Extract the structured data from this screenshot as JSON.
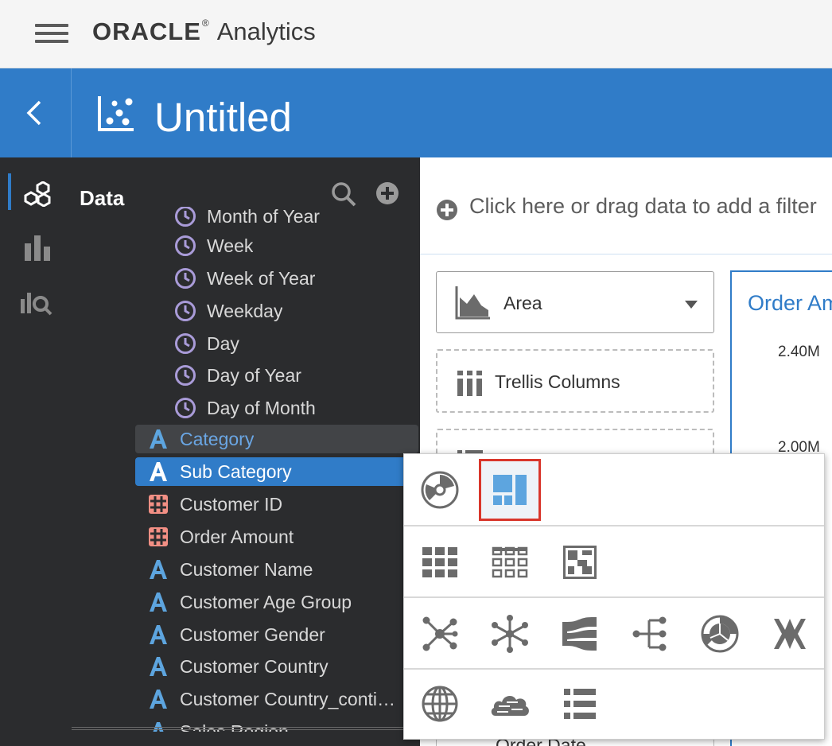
{
  "header": {
    "brand_oracle": "ORACLE",
    "brand_reg": "®",
    "brand_product": "Analytics"
  },
  "titlebar": {
    "project_title": "Untitled"
  },
  "data_panel": {
    "title": "Data",
    "items": [
      {
        "label": "Month of Year",
        "type": "time"
      },
      {
        "label": "Week",
        "type": "time"
      },
      {
        "label": "Week of Year",
        "type": "time"
      },
      {
        "label": "Weekday",
        "type": "time"
      },
      {
        "label": "Day",
        "type": "time"
      },
      {
        "label": "Day of Year",
        "type": "time"
      },
      {
        "label": "Day of Month",
        "type": "time"
      },
      {
        "label": "Category",
        "type": "attribute",
        "state": "hover"
      },
      {
        "label": "Sub Category",
        "type": "attribute",
        "state": "selected"
      },
      {
        "label": "Customer ID",
        "type": "measure"
      },
      {
        "label": "Order Amount",
        "type": "measure"
      },
      {
        "label": "Customer Name",
        "type": "attribute"
      },
      {
        "label": "Customer Age Group",
        "type": "attribute"
      },
      {
        "label": "Customer Gender",
        "type": "attribute"
      },
      {
        "label": "Customer Country",
        "type": "attribute"
      },
      {
        "label": "Customer Country_conti…",
        "type": "attribute"
      },
      {
        "label": "Sales Region",
        "type": "attribute"
      }
    ]
  },
  "filterbar": {
    "text": "Click here or drag data to add a filter"
  },
  "grammar": {
    "viz_type": "Area",
    "dropzones": [
      {
        "label": "Trellis Columns"
      },
      {
        "label": ""
      }
    ],
    "bottom_item": "Order Date"
  },
  "canvas": {
    "title": "Order Amount",
    "ticks": [
      "2.40M",
      "2.00M"
    ]
  },
  "palette": {
    "rows": [
      [
        "performance-tile-icon",
        "tile-layout-icon"
      ],
      [
        "heat-grid-icon",
        "table-grid-icon",
        "treemap-icon"
      ],
      [
        "network-icon",
        "chord-network-icon",
        "sankey-icon",
        "tree-diagram-icon",
        "sunburst-icon",
        "parallel-coordinates-icon"
      ],
      [
        "map-globe-icon",
        "tag-cloud-icon",
        "list-icon"
      ]
    ],
    "selected": "tile-layout-icon"
  },
  "colors": {
    "accent_blue": "#307cc8",
    "panel_dark": "#2b2c2e",
    "time_icon": "#a99bd8",
    "attribute_icon": "#5da5df",
    "measure_icon": "#f28f84",
    "selection_red": "#d9362b"
  }
}
